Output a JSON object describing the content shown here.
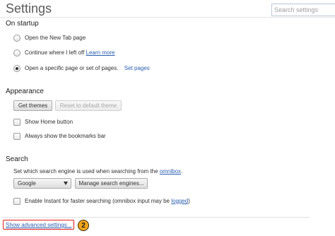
{
  "header": {
    "title": "Settings",
    "search_placeholder": "Search settings"
  },
  "startup": {
    "heading": "On startup",
    "options": [
      {
        "label": "Open the New Tab page",
        "checked": false
      },
      {
        "label": "Continue where I left off",
        "link": "Learn more",
        "checked": false
      },
      {
        "label": "Open a specific page or set of pages.",
        "link": "Set pages",
        "checked": true
      }
    ]
  },
  "appearance": {
    "heading": "Appearance",
    "get_themes": "Get themes",
    "reset_theme": "Reset to default theme",
    "checkboxes": [
      {
        "label": "Show Home button",
        "checked": false
      },
      {
        "label": "Always show the bookmarks bar",
        "checked": false
      }
    ]
  },
  "search": {
    "heading": "Search",
    "description": "Set which search engine is used when searching from the",
    "description_link": "omnibox",
    "description_end": ".",
    "engine_selected": "Google",
    "manage_button": "Manage search engines...",
    "instant_label": "Enable Instant for faster searching (omnibox input may be",
    "instant_link": "logged",
    "instant_end": ")",
    "instant_checked": false
  },
  "footer": {
    "advanced_link": "Show advanced settings...",
    "callout_number": "2"
  },
  "colors": {
    "link": "#2a5db0",
    "callout_border": "#e0201a",
    "badge": "#f2a51c"
  }
}
